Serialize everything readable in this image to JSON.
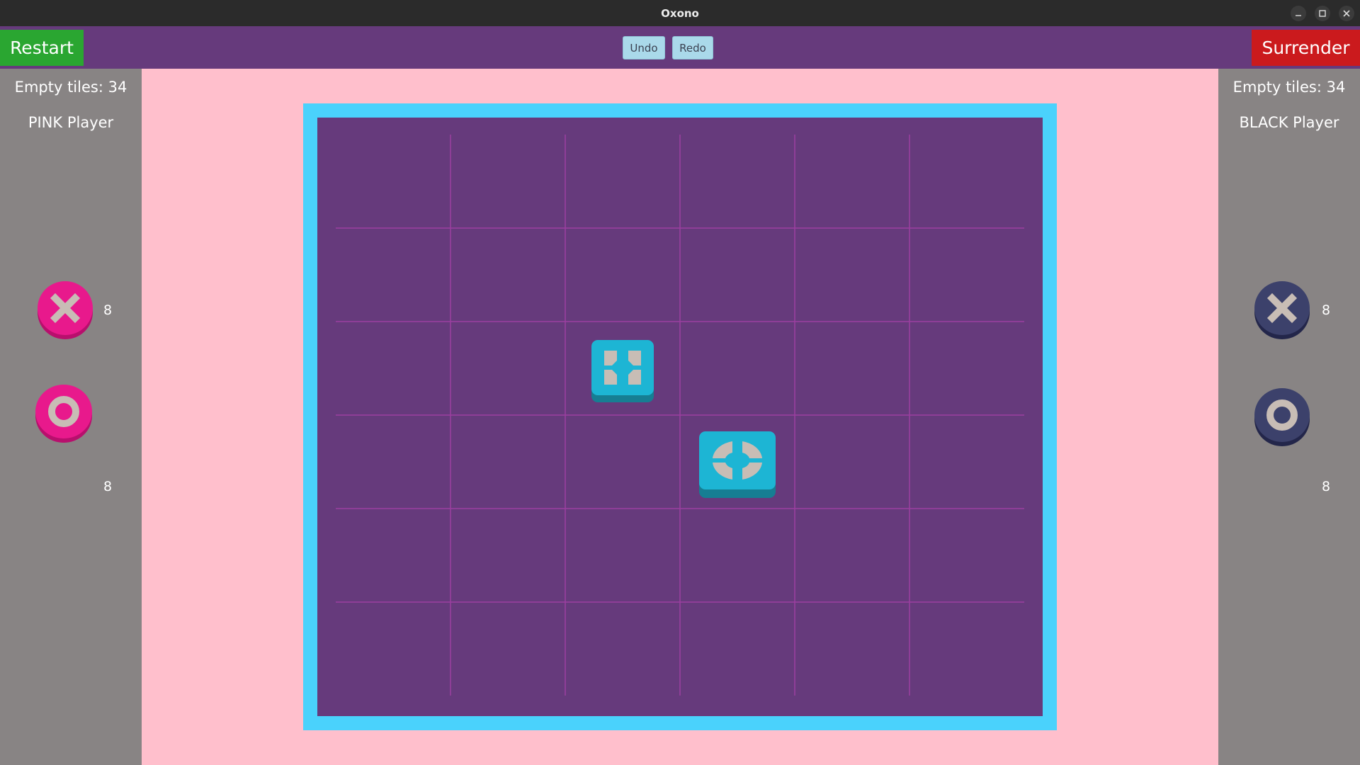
{
  "window": {
    "title": "Oxono"
  },
  "toolbar": {
    "restart_label": "Restart",
    "undo_label": "Undo",
    "redo_label": "Redo",
    "surrender_label": "Surrender"
  },
  "players": [
    {
      "id": "pink",
      "empty_tiles_text": "Empty tiles: 34",
      "name": "PINK Player",
      "color": "#e8198c",
      "x_count": "8",
      "o_count": "8"
    },
    {
      "id": "black",
      "empty_tiles_text": "Empty tiles: 34",
      "name": "BLACK Player",
      "color": "#3c416b",
      "x_count": "8",
      "o_count": "8"
    }
  ],
  "board": {
    "rows": 6,
    "cols": 6,
    "frame_color": "#4ad2fc",
    "board_color": "#663a7c",
    "grid_color": "#9c3fa0",
    "totems": [
      {
        "symbol": "X",
        "row": 2,
        "col": 2,
        "color": "#1db5d4"
      },
      {
        "symbol": "O",
        "row": 3,
        "col": 3,
        "color": "#1db5d4"
      }
    ],
    "placed_tokens": []
  },
  "colors": {
    "restart": "#2aa631",
    "surrender": "#cb1a1d",
    "toolbar": "#663a7c",
    "background": "#ffbfcc",
    "side_panel": "#888484",
    "token_symbol": "#c8bdb5"
  }
}
